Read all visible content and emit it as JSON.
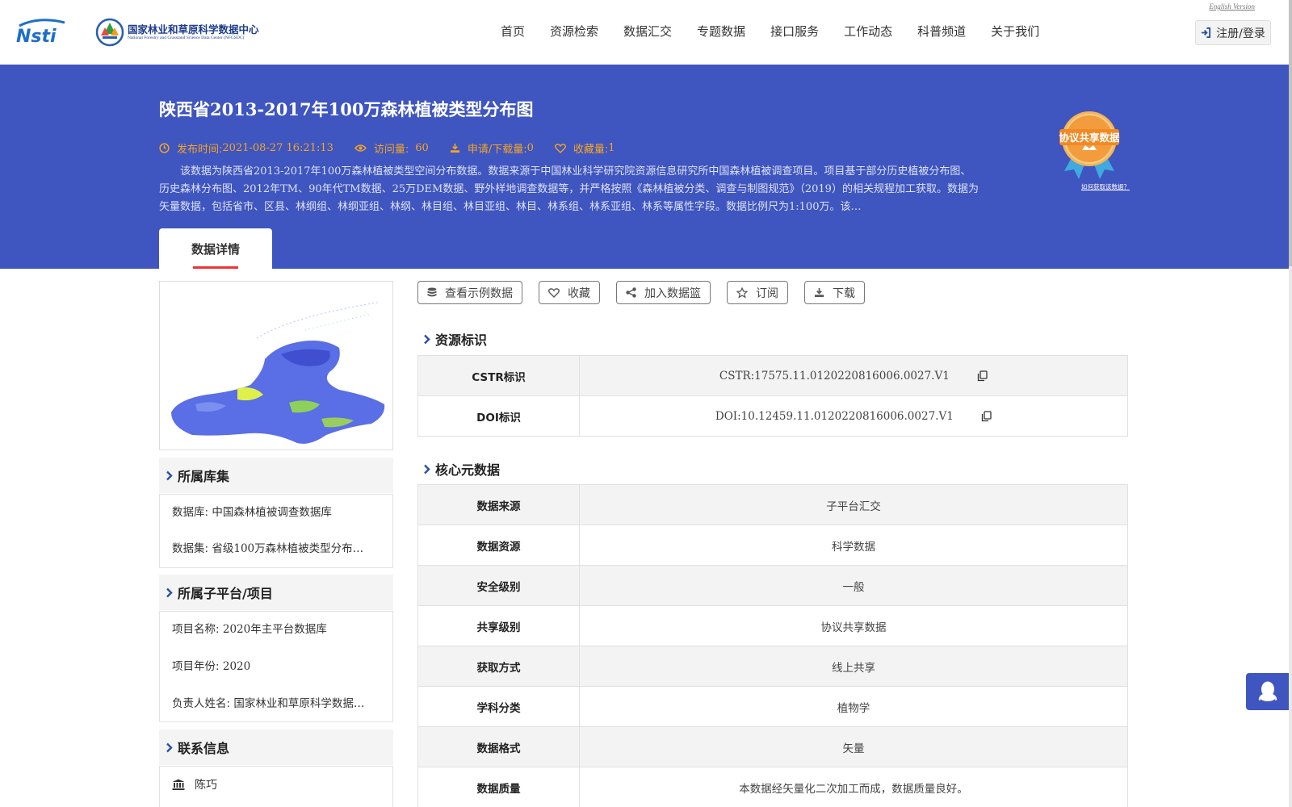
{
  "header": {
    "logo_nsti": "Nsti",
    "logo_cn": "国家林业和草原科学数据中心",
    "logo_en": "National Forestry and Grassland Science Data Center (NFGSDC)",
    "english_link": "English Version",
    "login": "注册/登录",
    "nav": [
      "首页",
      "资源检索",
      "数据汇交",
      "专题数据",
      "接口服务",
      "工作动态",
      "科普频道",
      "关于我们"
    ]
  },
  "banner": {
    "title": "陕西省2013-2017年100万森林植被类型分布图",
    "publish_label": "发布时间:",
    "publish_value": "2021-08-27 16:21:13",
    "visits_label": "访问量:",
    "visits_value": "60",
    "downloads_label": "申请/下载量:",
    "downloads_value": "0",
    "favorites_label": "收藏量:",
    "favorites_value": "1",
    "description": "该数据为陕西省2013-2017年100万森林植被类型空间分布数据。数据来源于中国林业科学研究院资源信息研究所中国森林植被调查项目。项目基于部分历史植被分布图、历史森林分布图、2012年TM、90年代TM数据、25万DEM数据、野外样地调查数据等，并严格按照《森林植被分类、调查与制图规范》（2019）的相关规程加工获取。数据为矢量数据，包括省市、区县、林纲组、林纲亚组、林纲、林目组、林目亚组、林目、林系组、林系亚组、林系等属性字段。数据比例尺为1:100万。该…",
    "badge": "协议共享数据",
    "badge_help": "如何获取该数据？",
    "tab": "数据详情"
  },
  "sidebar": {
    "library": {
      "title": "所属库集",
      "db_label": "数据库:",
      "db_value": "中国森林植被调查数据库",
      "set_label": "数据集:",
      "set_value": "省级100万森林植被类型分布…"
    },
    "project": {
      "title": "所属子平台/项目",
      "name_label": "项目名称:",
      "name_value": "2020年主平台数据库",
      "year_label": "项目年份:",
      "year_value": "2020",
      "owner_label": "负责人姓名:",
      "owner_value": "国家林业和草原科学数据…"
    },
    "contact": {
      "title": "联系信息",
      "name": "陈巧"
    }
  },
  "actions": {
    "sample": "查看示例数据",
    "favorite": "收藏",
    "cart": "加入数据篮",
    "subscribe": "订阅",
    "download": "下载"
  },
  "resource_id": {
    "title": "资源标识",
    "rows": [
      {
        "k": "CSTR标识",
        "v": "CSTR:17575.11.0120220816006.0027.V1"
      },
      {
        "k": "DOI标识",
        "v": "DOI:10.12459.11.0120220816006.0027.V1"
      }
    ]
  },
  "core_meta": {
    "title": "核心元数据",
    "rows": [
      {
        "k": "数据来源",
        "v": "子平台汇交"
      },
      {
        "k": "数据资源",
        "v": "科学数据"
      },
      {
        "k": "安全级别",
        "v": "一般"
      },
      {
        "k": "共享级别",
        "v": "协议共享数据"
      },
      {
        "k": "获取方式",
        "v": "线上共享"
      },
      {
        "k": "学科分类",
        "v": "植物学"
      },
      {
        "k": "数据格式",
        "v": "矢量"
      },
      {
        "k": "数据质量",
        "v": "本数据经矢量化二次加工而成，数据质量良好。"
      }
    ]
  },
  "colors": {
    "banner": "#3f55bf",
    "accent": "#f5a623",
    "tab_underline": "#e33333"
  }
}
